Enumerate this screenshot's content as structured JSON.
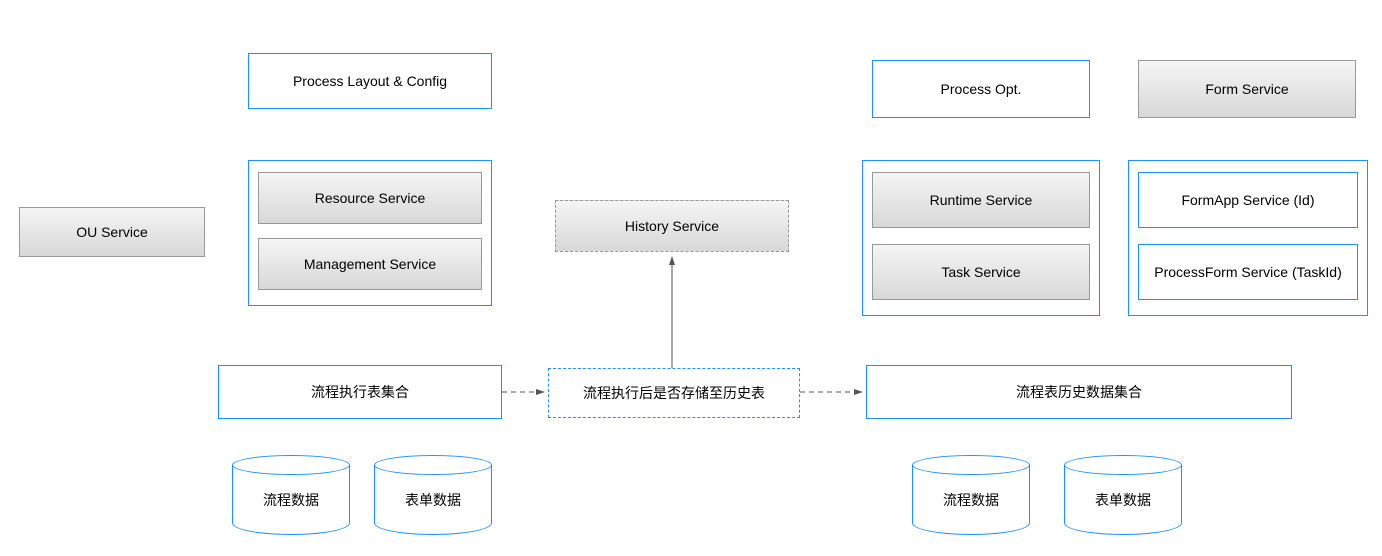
{
  "boxes": {
    "ou_service": "OU Service",
    "process_layout_config": "Process Layout & Config",
    "resource_service": "Resource Service",
    "management_service": "Management Service",
    "history_service": "History Service",
    "process_opt": "Process Opt.",
    "form_service": "Form Service",
    "runtime_service": "Runtime Service",
    "task_service": "Task Service",
    "formapp_service": "FormApp Service (Id)",
    "processform_service": "ProcessForm Service (TaskId)",
    "flow_exec_collection": "流程执行表集合",
    "flow_exec_decision": "流程执行后是否存储至历史表",
    "flow_history_collection": "流程表历史数据集合"
  },
  "cylinders": {
    "left_flow": "流程数据",
    "left_form": "表单数据",
    "right_flow": "流程数据",
    "right_form": "表单数据"
  }
}
